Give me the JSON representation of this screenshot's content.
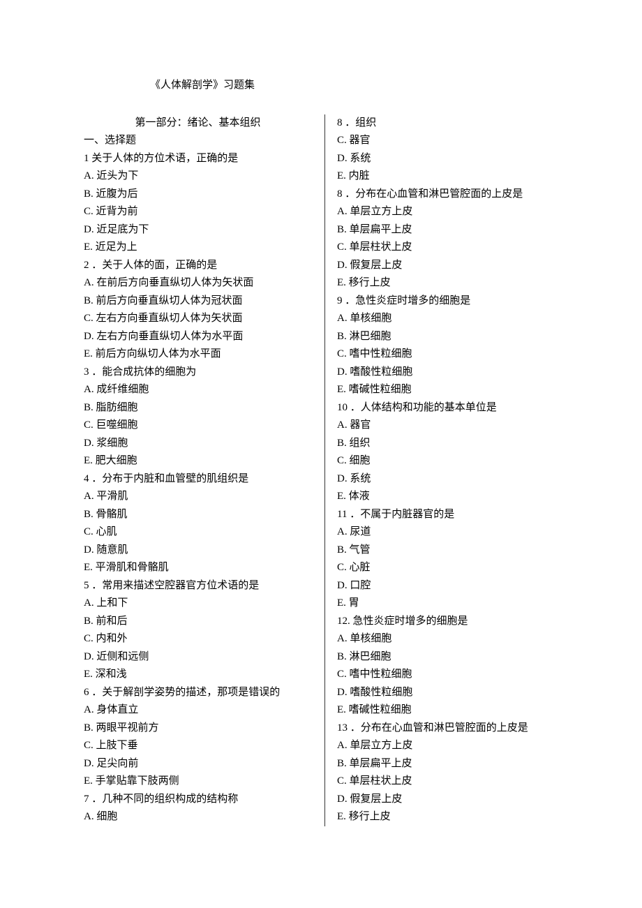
{
  "title": "《人体解剖学》习题集",
  "subtitle": "第一部分：绪论、基本组织",
  "sectionHeader": "一、选择题",
  "leftLines": [
    "1 关于人体的方位术语，正确的是",
    "A. 近头为下",
    "B. 近腹为后",
    "C. 近背为前",
    "D. 近足底为下",
    "E. 近足为上",
    "2 ．关于人体的面，正确的是",
    "A. 在前后方向垂直纵切人体为矢状面",
    "B. 前后方向垂直纵切人体为冠状面",
    "C. 左右方向垂直纵切人体为矢状面",
    "D. 左右方向垂直纵切人体为水平面",
    "E. 前后方向纵切人体为水平面",
    "3 ．能合成抗体的细胞为",
    "A. 成纤维细胞",
    "B. 脂肪细胞",
    "C. 巨噬细胞",
    "D. 浆细胞",
    "E. 肥大细胞",
    "4 ．分布于内脏和血管壁的肌组织是",
    "A. 平滑肌",
    "B. 骨骼肌",
    "C. 心肌",
    "D. 随意肌",
    "E. 平滑肌和骨骼肌",
    "5 ．常用来描述空腔器官方位术语的是",
    "A. 上和下",
    "B. 前和后",
    "C. 内和外",
    "D. 近侧和远侧",
    "E. 深和浅",
    "6 ．关于解剖学姿势的描述，那项是错误的",
    "A. 身体直立",
    "B. 两眼平视前方",
    "C. 上肢下垂",
    "D. 足尖向前",
    "E. 手掌贴靠下肢两侧",
    "7 ．几种不同的组织构成的结构称"
  ],
  "rightLines": [
    "A. 细胞",
    "8 ．组织",
    "C. 器官",
    "D. 系统",
    "E. 内脏",
    "8 ．分布在心血管和淋巴管腔面的上皮是",
    "A. 单层立方上皮",
    "B. 单层扁平上皮",
    "C. 单层柱状上皮",
    "D. 假复层上皮",
    "E. 移行上皮",
    "9 ．急性炎症时增多的细胞是",
    "A. 单核细胞",
    "B. 淋巴细胞",
    "C. 嗜中性粒细胞",
    "D. 嗜酸性粒细胞",
    "E. 嗜碱性粒细胞",
    "10 ．人体结构和功能的基本单位是",
    "A. 器官",
    "B. 组织",
    "C. 细胞",
    "D. 系统",
    "E. 体液",
    "11 ．不属于内脏器官的是",
    "A. 尿道",
    "B. 气管",
    "C. 心脏",
    "D. 口腔",
    "E. 胃",
    "12. 急性炎症时增多的细胞是",
    "A. 单核细胞",
    "B. 淋巴细胞",
    "C. 嗜中性粒细胞",
    "D. 嗜酸性粒细胞",
    "E. 嗜碱性粒细胞",
    "13 ．分布在心血管和淋巴管腔面的上皮是",
    "A. 单层立方上皮",
    "B. 单层扁平上皮",
    "C. 单层柱状上皮",
    "D. 假复层上皮",
    "E. 移行上皮"
  ]
}
